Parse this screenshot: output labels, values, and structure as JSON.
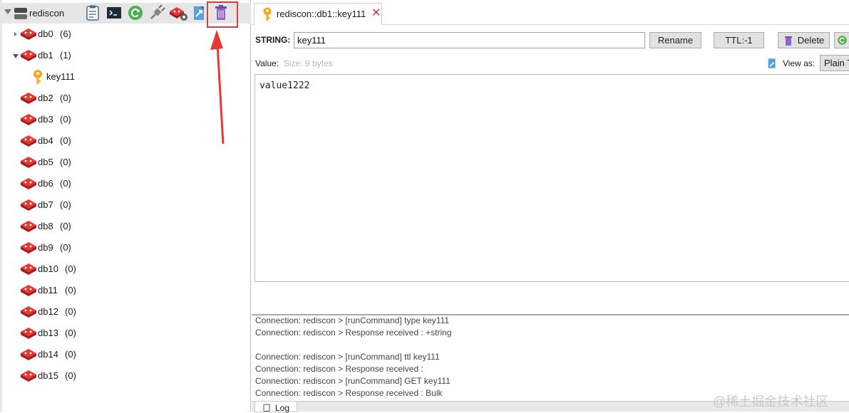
{
  "connection": {
    "name": "rediscon"
  },
  "toolbar": {
    "icons": [
      "console-log-icon",
      "terminal-icon",
      "reload-icon",
      "plug-icon",
      "redis-settings-icon",
      "export-icon",
      "trash-icon"
    ]
  },
  "tree": {
    "databases": [
      {
        "name": "db0",
        "count": "(6)",
        "expanded": false
      },
      {
        "name": "db1",
        "count": "(1)",
        "expanded": true
      },
      {
        "name": "db2",
        "count": "(0)"
      },
      {
        "name": "db3",
        "count": "(0)"
      },
      {
        "name": "db4",
        "count": "(0)"
      },
      {
        "name": "db5",
        "count": "(0)"
      },
      {
        "name": "db6",
        "count": "(0)"
      },
      {
        "name": "db7",
        "count": "(0)"
      },
      {
        "name": "db8",
        "count": "(0)"
      },
      {
        "name": "db9",
        "count": "(0)"
      },
      {
        "name": "db10",
        "count": "(0)"
      },
      {
        "name": "db11",
        "count": "(0)"
      },
      {
        "name": "db12",
        "count": "(0)"
      },
      {
        "name": "db13",
        "count": "(0)"
      },
      {
        "name": "db14",
        "count": "(0)"
      },
      {
        "name": "db15",
        "count": "(0)"
      }
    ],
    "keys": [
      {
        "name": "key111"
      }
    ]
  },
  "tab": {
    "title": "rediscon::db1::key111"
  },
  "editor": {
    "type_label": "STRING:",
    "key_value": "key111",
    "rename_label": "Rename",
    "ttl_label": "TTL:-1",
    "delete_label": "Delete",
    "value_label": "Value:",
    "size_label": "Size: 9 bytes",
    "view_as_label": "View as:",
    "view_as_value": "Plain Text",
    "value_text": "value1222"
  },
  "log": {
    "lines": [
      "Connection: rediscon > [runCommand] type key111",
      "Connection: rediscon > Response received : +string",
      "",
      "Connection: rediscon > [runCommand] ttl key111",
      "Connection: rediscon > Response received :",
      "Connection: rediscon > [runCommand] GET key111",
      "Connection: rediscon > Response received : Bulk"
    ],
    "tab_label": "Log"
  },
  "watermark": "@稀土掘金技术社区",
  "colors": {
    "highlight": "#e53935",
    "redis_red": "#c62828",
    "key_gold": "#f5a623"
  }
}
